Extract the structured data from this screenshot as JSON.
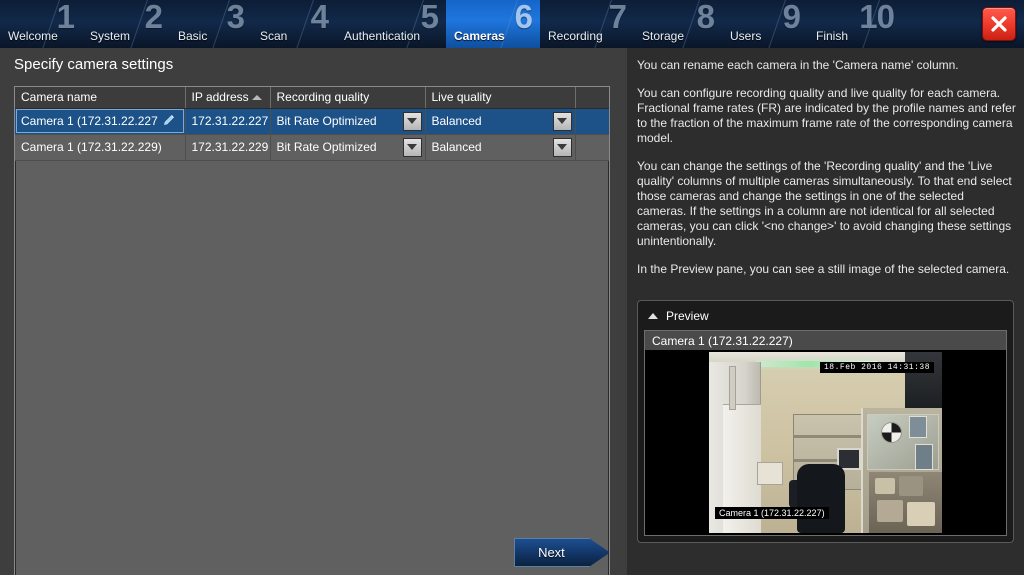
{
  "window": {
    "close_label": "close-icon"
  },
  "stepbar": {
    "steps": [
      {
        "number": "1",
        "label": "Welcome",
        "active": false,
        "width": 82
      },
      {
        "number": "2",
        "label": "System",
        "active": false,
        "width": 88
      },
      {
        "number": "3",
        "label": "Basic",
        "active": false,
        "width": 82
      },
      {
        "number": "4",
        "label": "Scan",
        "active": false,
        "width": 84
      },
      {
        "number": "5",
        "label": "Authentication",
        "active": false,
        "width": 110
      },
      {
        "number": "6",
        "label": "Cameras",
        "active": true,
        "width": 94
      },
      {
        "number": "7",
        "label": "Recording",
        "active": false,
        "width": 94
      },
      {
        "number": "8",
        "label": "Storage",
        "active": false,
        "width": 88
      },
      {
        "number": "9",
        "label": "Users",
        "active": false,
        "width": 86
      },
      {
        "number": "10",
        "label": "Finish",
        "active": false,
        "width": 94
      }
    ]
  },
  "main": {
    "page_title": "Specify camera settings",
    "next_label": "Next"
  },
  "table": {
    "columns": [
      {
        "label": "Camera name",
        "sorted": false
      },
      {
        "label": "IP address",
        "sorted": true
      },
      {
        "label": "Recording quality",
        "sorted": false
      },
      {
        "label": "Live quality",
        "sorted": false
      },
      {
        "label": "",
        "sorted": false
      }
    ],
    "rows": [
      {
        "name": "Camera 1 (172.31.22.227",
        "ip": "172.31.22.227",
        "recording_quality": "Bit Rate Optimized",
        "live_quality": "Balanced",
        "selected": true,
        "editable": true
      },
      {
        "name": "Camera 1 (172.31.22.229)",
        "ip": "172.31.22.229",
        "recording_quality": "Bit Rate Optimized",
        "live_quality": "Balanced",
        "selected": false,
        "editable": false
      }
    ]
  },
  "help": {
    "paragraphs": [
      "You can rename each camera in the 'Camera name' column.",
      "You can configure recording quality and live quality for each camera. Fractional frame rates (FR) are indicated by the profile names and refer to the fraction of the maximum frame rate of the corresponding camera model.",
      "You can change the settings of the 'Recording quality' and the 'Live quality' columns of multiple cameras simultaneously. To that end select those cameras and change the settings in one of the selected cameras. If the settings in a column are not identical for all selected cameras, you can click '<no change>' to avoid changing these settings unintentionally.",
      "In the Preview pane, you can see a still image of the selected camera."
    ]
  },
  "preview": {
    "title": "Preview",
    "camera_caption": "Camera 1 (172.31.22.227)",
    "timestamp_overlay": "18.Feb 2016   14:31:38",
    "camera_overlay": "Camera 1 (172.31.22.227)"
  },
  "colors": {
    "accent_blue": "#1f76de",
    "selected_row": "#1d5288",
    "close_red": "#ef3b2c",
    "pane_bg": "#3e3e3e",
    "help_bg": "#2d2d2d",
    "table_bg": "#606060"
  }
}
